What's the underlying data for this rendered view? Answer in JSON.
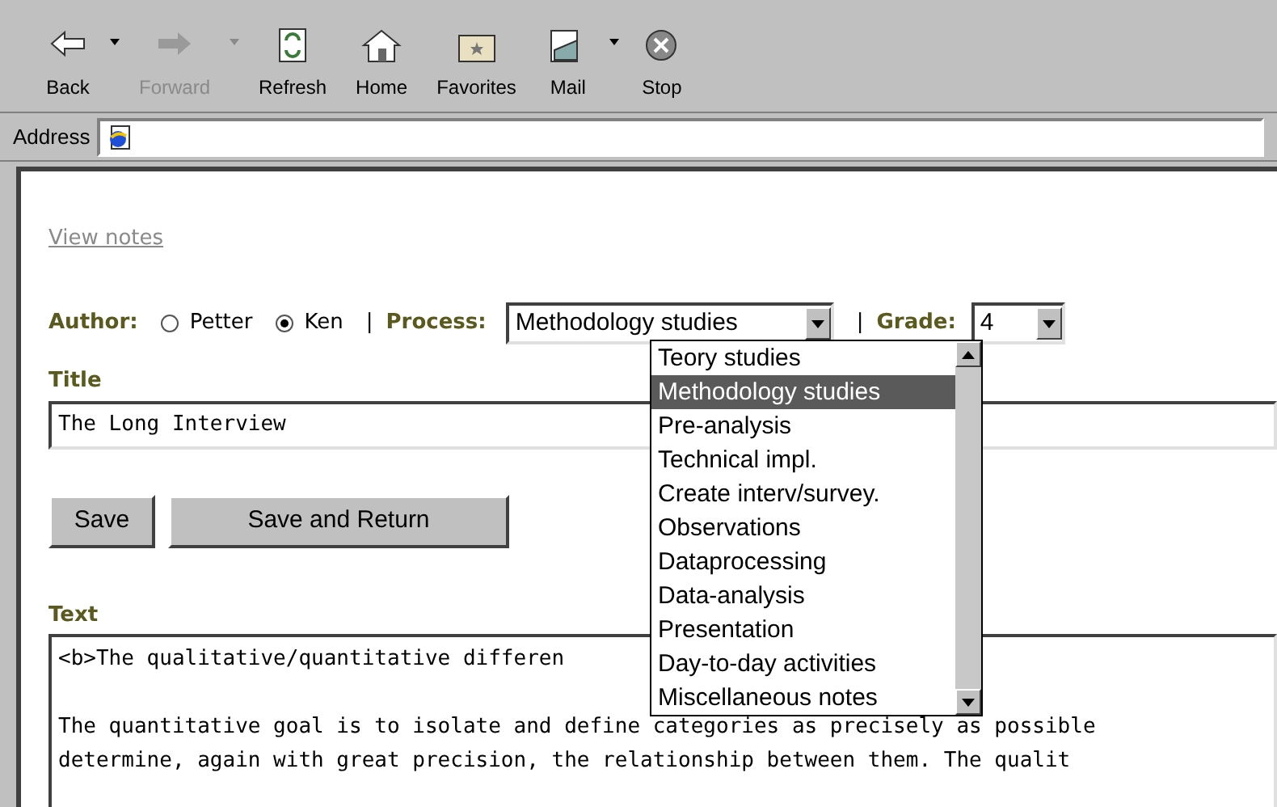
{
  "toolbar": [
    {
      "label": "Back",
      "kind": "back",
      "disabled": false,
      "menu": true
    },
    {
      "label": "Forward",
      "kind": "forward",
      "disabled": true,
      "menu": true
    },
    {
      "label": "Refresh",
      "kind": "refresh",
      "disabled": false,
      "menu": false
    },
    {
      "label": "Home",
      "kind": "home",
      "disabled": false,
      "menu": false
    },
    {
      "label": "Favorites",
      "kind": "favorites",
      "disabled": false,
      "menu": false
    },
    {
      "label": "Mail",
      "kind": "mail",
      "disabled": false,
      "menu": true
    },
    {
      "label": "Stop",
      "kind": "stop",
      "disabled": false,
      "menu": false
    }
  ],
  "address_bar": {
    "label": "Address"
  },
  "page": {
    "view_notes_link": "View notes",
    "author": {
      "label": "Author:",
      "options": [
        {
          "label": "Petter",
          "selected": false
        },
        {
          "label": "Ken",
          "selected": true
        }
      ]
    },
    "separator_1": "|",
    "process": {
      "label": "Process:",
      "value": "Methodology studies",
      "expanded": true,
      "options": [
        {
          "label": "Teory studies",
          "selected": false
        },
        {
          "label": "Methodology studies",
          "selected": true
        },
        {
          "label": "Pre-analysis",
          "selected": false
        },
        {
          "label": "Technical impl.",
          "selected": false
        },
        {
          "label": "Create interv/survey.",
          "selected": false
        },
        {
          "label": "Observations",
          "selected": false
        },
        {
          "label": "Dataprocessing",
          "selected": false
        },
        {
          "label": "Data-analysis",
          "selected": false
        },
        {
          "label": "Presentation",
          "selected": false
        },
        {
          "label": "Day-to-day activities",
          "selected": false
        },
        {
          "label": "Miscellaneous notes",
          "selected": false
        }
      ]
    },
    "separator_2": "|",
    "grade": {
      "label": "Grade:",
      "value": "4"
    },
    "title": {
      "label": "Title",
      "value": "The Long Interview"
    },
    "buttons": [
      "Save",
      "Save and Return"
    ],
    "text": {
      "label": "Text",
      "paragraphs": [
        [
          "<b>The qualitative/quantitative differen"
        ],
        [
          "The quantitative goal is to isolate and define categories as precisely as possible",
          "determine, again with great precision, the relationship between them. The qualit"
        ]
      ]
    }
  }
}
